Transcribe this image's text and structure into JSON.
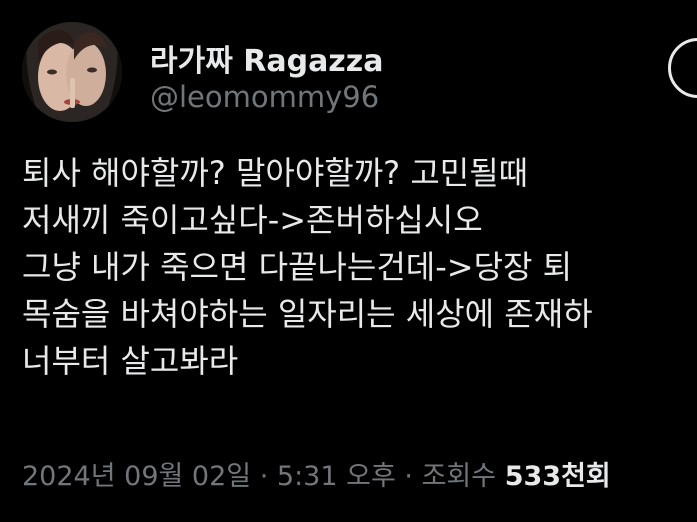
{
  "author": {
    "display_name": "라가짜 Ragazza",
    "handle": "@leomommy96"
  },
  "tweet": {
    "lines": [
      "퇴사 해야할까? 말아야할까? 고민될때",
      "저새끼 죽이고싶다->존버하십시오",
      "그냥 내가 죽으면 다끝나는건데->당장 퇴",
      "목숨을 바쳐야하는 일자리는 세상에 존재하",
      "너부터 살고봐라"
    ]
  },
  "meta": {
    "date": "2024년 09월 02일",
    "separator": "·",
    "time": "5:31 오후",
    "views_label": "조회수",
    "views_count": "533천",
    "views_suffix": "회"
  },
  "colors": {
    "background": "#000000",
    "text_primary": "#e7e9ea",
    "text_secondary": "#71767b"
  },
  "icons": {
    "more": "more-options-icon"
  }
}
